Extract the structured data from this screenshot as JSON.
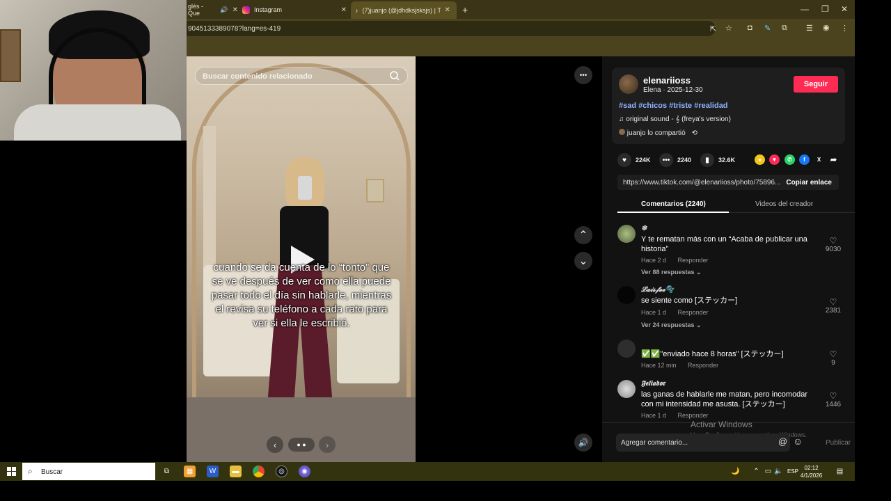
{
  "browser": {
    "tabs": [
      {
        "label": "glés - Que",
        "active": false
      },
      {
        "label": "Instagram",
        "active": false
      },
      {
        "label": "(7)juanjo (@jdhdksjsksjs) | TikTo",
        "active": true
      }
    ],
    "url": "9045133389078?lang=es-419",
    "new_tab": "+"
  },
  "video": {
    "search_placeholder": "Buscar contenido relacionado",
    "caption": "cuando se da cuenta de lo “tonto” que se ve después de ver como ella puede pasar todo el día sin hablarle, mientras el revisa su teléfono a cada rato para ver si ella le escribió.",
    "more_glyph": "•••"
  },
  "post": {
    "username": "elenariioss",
    "subname": "Elena · 2025-12-30",
    "follow_label": "Seguir",
    "hashtags": "#sad #chicos #triste #realidad",
    "sound": "original sound - 𝄞 (freya's version)",
    "shared_by": "juanjo lo compartió",
    "likes": "224K",
    "comments": "2240",
    "saves": "32.6K",
    "link": "https://www.tiktok.com/@elenariioss/photo/75896...",
    "copy_label": "Copiar enlace",
    "tab_comments": "Comentarios (2240)",
    "tab_creator": "Videos del creador"
  },
  "comments": [
    {
      "name": "❄",
      "text": "Y te rematan más con un “Acaba de publicar una historia”",
      "time": "Hace 2 d",
      "reply": "Responder",
      "more": "Ver 88 respuestas ⌄",
      "likes": "9030"
    },
    {
      "name": "𝓛𝓪𝓲𝓼𝓯𝓮𝓮🫧",
      "text": "se siente como [ステッカー]",
      "time": "Hace 1 d",
      "reply": "Responder",
      "more": "Ver 24 respuestas ⌄",
      "likes": "2381"
    },
    {
      "name": "",
      "text": "✅✅\"enviado hace 8 horas\" [ステッカー]",
      "time": "Hace 12 min",
      "reply": "Responder",
      "more": "",
      "likes": "9"
    },
    {
      "name": "𝕱𝖊𝖑𝖎𝖆𝖉𝖔𝖗",
      "text": "las ganas de hablarle me matan, pero incomodar con mi intensidad me asusta. [ステッカー]",
      "time": "Hace 1 d",
      "reply": "Responder",
      "more": "",
      "likes": "1446"
    }
  ],
  "compose": {
    "placeholder": "Agregar comentario...",
    "publish": "Publicar"
  },
  "watermark": {
    "title": "Activar Windows",
    "subtitle": "Ve a Configuración para activar Windows."
  },
  "taskbar": {
    "search": "Buscar",
    "lang": "ESP",
    "time": "02:12",
    "date": "4/1/2026"
  },
  "colors": {
    "accent": "#fe2c55",
    "hashtag": "#8fb2ff",
    "chrome": "#4b431d"
  }
}
